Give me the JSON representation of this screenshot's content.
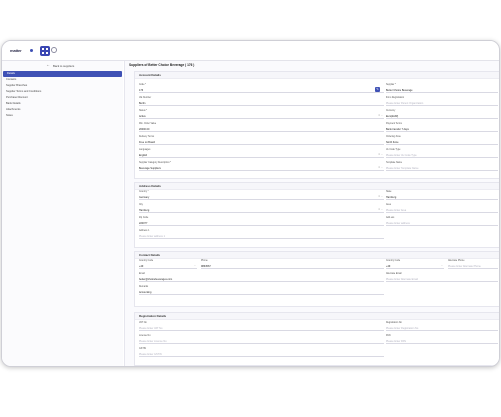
{
  "app": {
    "logo_text": "matter"
  },
  "page": {
    "title": "Suppliers of Better Choice Beverage ( 176 )"
  },
  "sidebar": {
    "back_label": "Back to suppliers",
    "items": [
      {
        "label": "Details",
        "active": true
      },
      {
        "label": "Contacts"
      },
      {
        "label": "Supplier Branches"
      },
      {
        "label": "Supplier Terms and Conditions"
      },
      {
        "label": "Purchase Discount"
      },
      {
        "label": "Bank Details"
      },
      {
        "label": "Attachments"
      },
      {
        "label": "Notes"
      }
    ]
  },
  "account": {
    "title": "Account Details",
    "code": {
      "label": "Code *",
      "value": "176"
    },
    "supplier": {
      "label": "Supplier *",
      "value": "Better Choice Beverage"
    },
    "vat_number": {
      "label": "Vat Number",
      "value": "Berlin"
    },
    "ibrno": {
      "label": "Ibrno Registration",
      "placeholder": "Please Enter Parent Organization"
    },
    "status": {
      "label": "Status *",
      "value": "Active"
    },
    "currency": {
      "label": "Currency",
      "value": "Euro(EUR)"
    },
    "min_order": {
      "label": "Min. Order Value",
      "value": "20000.00"
    },
    "payment_terms": {
      "label": "Payment Terms",
      "value": "Bank transfer 7 days"
    },
    "delivery_terms": {
      "label": "Delivery Terms",
      "value": "Free on Board"
    },
    "ordering_zone": {
      "label": "Ordering Zone",
      "value": "North Zone"
    },
    "language": {
      "label": "Languages",
      "value": "English"
    },
    "ve_code_type": {
      "label": "Ve Code Type",
      "placeholder": "Please Enter Ve Code Type"
    },
    "supplier_category": {
      "label": "Supplier Category Description *",
      "value": "Beverage Suppliers"
    },
    "template_name": {
      "label": "Template Name",
      "placeholder": "Please Enter Template Name"
    }
  },
  "address": {
    "title": "Address Details",
    "country": {
      "label": "Country *",
      "value": "Germany"
    },
    "state": {
      "label": "State",
      "value": "Hamburg"
    },
    "city": {
      "label": "City",
      "value": "Hamburg"
    },
    "area": {
      "label": "Area",
      "placeholder": "Please Enter Area"
    },
    "zip_code": {
      "label": "Zip Code",
      "value": "220077"
    },
    "address2": {
      "label": "Add ess",
      "placeholder": "Please Enter address"
    },
    "address": {
      "label": "Address 1",
      "placeholder": "Please Enter address 1"
    }
  },
  "contact": {
    "title": "Contact Details",
    "country_code": {
      "label": "Country Code",
      "value": "+49"
    },
    "phone": {
      "label": "Phone",
      "value": "9864567"
    },
    "country_code2": {
      "label": "Country Code",
      "value": "+49"
    },
    "alt_phone": {
      "label": "Alternate Phone",
      "placeholder": "Please Enter Alternate Phone"
    },
    "email": {
      "label": "Email",
      "value": "better@choicebeverages.com"
    },
    "alt_email": {
      "label": "Alternate Email",
      "placeholder": "Please Enter Alternate Email"
    },
    "remarks": {
      "label": "Remarks",
      "value": "Accounting"
    }
  },
  "registration": {
    "title": "Registration Details",
    "vat_no": {
      "label": "VAT No",
      "placeholder": "Please Enter VAT No"
    },
    "reg_no": {
      "label": "Registration No",
      "placeholder": "Please Enter Registration No"
    },
    "license_no": {
      "label": "License No",
      "placeholder": "Please Enter License No"
    },
    "pan": {
      "label": "PAN",
      "placeholder": "Please Enter PAN"
    },
    "gstin": {
      "label": "GSTIN",
      "placeholder": "Please Enter GSTIN"
    }
  },
  "colors": {
    "accent": "#3f51b5"
  }
}
